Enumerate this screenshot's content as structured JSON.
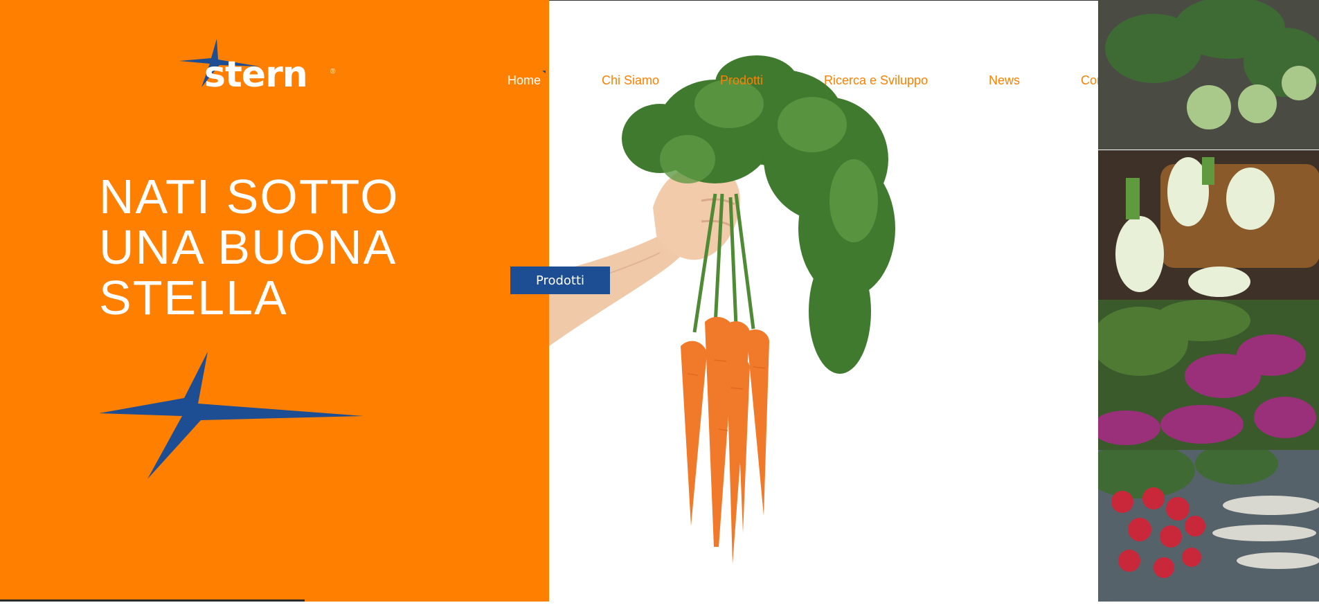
{
  "brand": {
    "logo_text": "stern",
    "logo_mark": "®",
    "colors": {
      "orange": "#FF8000",
      "blue": "#1D4E93",
      "white": "#FFFFFF"
    }
  },
  "nav": {
    "items": [
      {
        "label": "Home",
        "active": true
      },
      {
        "label": "Chi Siamo",
        "active": false
      },
      {
        "label": "Prodotti",
        "active": false
      },
      {
        "label": "Ricerca e Sviluppo",
        "active": false
      },
      {
        "label": "News",
        "active": false
      },
      {
        "label": "Contatti",
        "active": false
      }
    ]
  },
  "hero": {
    "headline_lines": [
      "NATI SOTTO",
      "UNA BUONA",
      "STELLA"
    ],
    "cta_label": "Prodotti"
  },
  "icons": {
    "logo_star": "star-icon",
    "hero_star": "star-icon",
    "nav_marker": "triangle-icon"
  },
  "images": [
    "carrot-bunch-image",
    "kohlrabi-image",
    "fennel-image",
    "turnip-image",
    "radish-image"
  ]
}
